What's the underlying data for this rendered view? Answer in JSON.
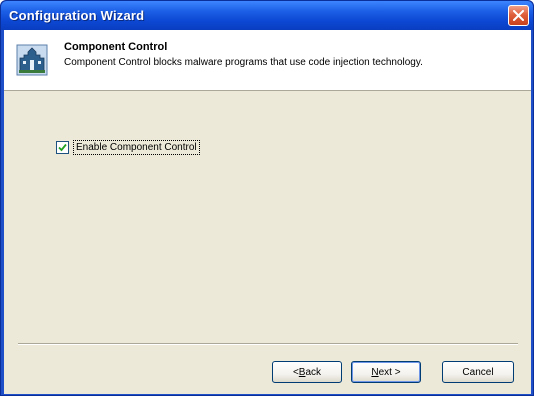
{
  "window": {
    "title": "Configuration Wizard",
    "close_icon": "close-x-icon"
  },
  "header": {
    "icon": "wizard-castle-icon",
    "title": "Component Control",
    "description": "Component Control blocks malware programs that use code injection technology."
  },
  "option": {
    "checkbox_label": "Enable Component Control",
    "checked": true
  },
  "buttons": {
    "back_prefix": "< ",
    "back_accel": "B",
    "back_rest": "ack",
    "next_accel": "N",
    "next_rest": "ext >",
    "cancel": "Cancel"
  },
  "colors": {
    "titlebar": "#0c47d2",
    "client": "#ece9d8",
    "close_button": "#e0603c"
  }
}
